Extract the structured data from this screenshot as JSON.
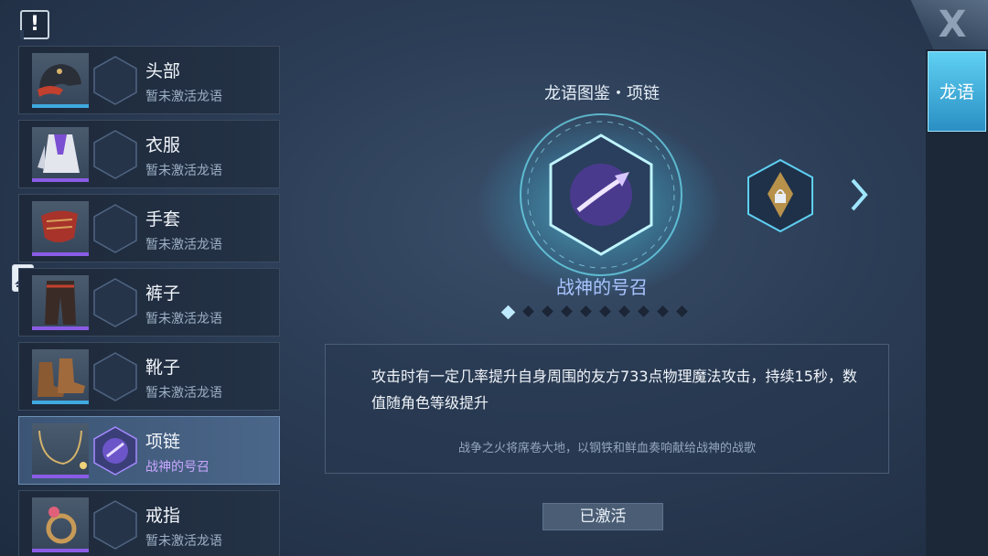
{
  "top": {
    "alert_label": "!"
  },
  "slots": [
    {
      "name": "头部",
      "status": "暂未激活龙语",
      "bar_color": "#3fa9e0"
    },
    {
      "name": "衣服",
      "status": "暂未激活龙语",
      "bar_color": "#8a5ce6"
    },
    {
      "name": "手套",
      "status": "暂未激活龙语",
      "bar_color": "#8a5ce6"
    },
    {
      "name": "裤子",
      "status": "暂未激活龙语",
      "bar_color": "#8a5ce6"
    },
    {
      "name": "靴子",
      "status": "暂未激活龙语",
      "bar_color": "#3fa9e0"
    },
    {
      "name": "项链",
      "status": "战神的号召",
      "bar_color": "#8a5ce6"
    },
    {
      "name": "戒指",
      "status": "暂未激活龙语",
      "bar_color": "#8a5ce6"
    }
  ],
  "right": {
    "close_label": "X",
    "tab_label": "龙语"
  },
  "main": {
    "codex_title": "龙语图鉴・项链",
    "ability_name": "战神的号召",
    "page_count": 10,
    "active_page": 1,
    "description": "攻击时有一定几率提升自身周围的友方733点物理魔法攻击，持续15秒，数值随角色等级提升",
    "flavor": "战争之火将席卷大地，以钢铁和鲜血奏响献给战神的战歌",
    "button_label": "已激活"
  },
  "colors": {
    "accent_cyan": "#5fd0f2",
    "purple": "#8a5ce6",
    "ability_text": "#a9c4ff"
  },
  "icons": [
    "alert-icon",
    "helmet-icon",
    "robe-icon",
    "gauntlet-icon",
    "pants-icon",
    "boots-icon",
    "necklace-icon",
    "ring-icon",
    "dragon-emblem-icon",
    "locked-emblem-icon",
    "chevron-right-icon",
    "close-icon",
    "person-card-icon"
  ]
}
